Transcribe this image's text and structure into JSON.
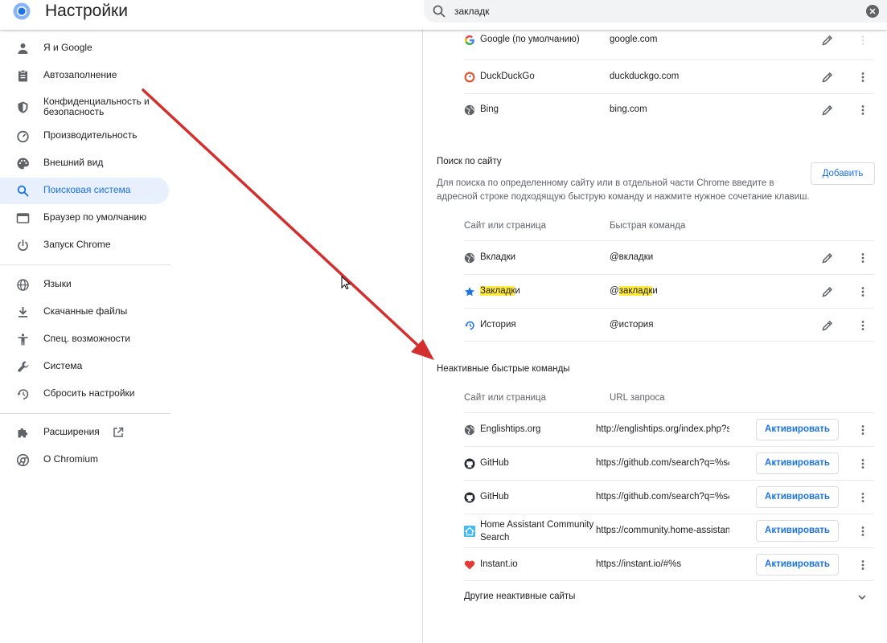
{
  "header": {
    "title": "Настройки",
    "search_value": "закладк"
  },
  "sidebar": {
    "group1": [
      {
        "label": "Я и Google",
        "icon": "person-icon"
      },
      {
        "label": "Автозаполнение",
        "icon": "clipboard-icon"
      },
      {
        "label": "Конфиденциальность и безопасность",
        "icon": "shield-icon"
      },
      {
        "label": "Производительность",
        "icon": "speedometer-icon"
      },
      {
        "label": "Внешний вид",
        "icon": "palette-icon"
      },
      {
        "label": "Поисковая система",
        "icon": "search-icon",
        "active": true
      },
      {
        "label": "Браузер по умолчанию",
        "icon": "browser-window-icon"
      },
      {
        "label": "Запуск Chrome",
        "icon": "power-icon"
      }
    ],
    "group2": [
      {
        "label": "Языки",
        "icon": "globe-icon"
      },
      {
        "label": "Скачанные файлы",
        "icon": "download-icon"
      },
      {
        "label": "Спец. возможности",
        "icon": "accessibility-icon"
      },
      {
        "label": "Система",
        "icon": "wrench-icon"
      },
      {
        "label": "Сбросить настройки",
        "icon": "history-icon"
      }
    ],
    "group3": [
      {
        "label": "Расширения",
        "icon": "puzzle-icon"
      },
      {
        "label": "О Chromium",
        "icon": "chromium-icon"
      }
    ]
  },
  "search_engines": [
    {
      "name": "Google (по умолчанию)",
      "key": "google.com",
      "icon": "google-icon"
    },
    {
      "name": "DuckDuckGo",
      "key": "duckduckgo.com",
      "icon": "duckduckgo-icon"
    },
    {
      "name": "Bing",
      "key": "bing.com",
      "icon": "globe-icon"
    }
  ],
  "site_search": {
    "title": "Поиск по сайту",
    "description": "Для поиска по определенному сайту или в отдельной части Chrome введите в адресной строке подходящую быструю команду и нажмите нужное сочетание клавиш.",
    "add_button": "Добавить",
    "col_site": "Сайт или страница",
    "col_shortcut": "Быстрая команда",
    "rows": [
      {
        "name": "Вкладки",
        "shortcut": "@вкладки",
        "icon": "globe-icon"
      },
      {
        "name_highlight": "Закладк",
        "name_rest": "и",
        "shortcut_prefix": "@",
        "shortcut_highlight": "закладк",
        "shortcut_rest": "и",
        "icon": "star-icon"
      },
      {
        "name": "История",
        "shortcut": "@история",
        "icon": "history-icon"
      }
    ]
  },
  "inactive": {
    "title": "Неактивные быстрые команды",
    "col_site": "Сайт или страница",
    "col_url": "URL запроса",
    "activate_label": "Активировать",
    "rows": [
      {
        "name": "Englishtips.org",
        "url": "http://englishtips.org/index.php?s",
        "icon": "globe-icon"
      },
      {
        "name": "GitHub",
        "url": "https://github.com/search?q=%s&",
        "icon": "github-icon"
      },
      {
        "name": "GitHub",
        "url": "https://github.com/search?q=%s&",
        "icon": "github-icon"
      },
      {
        "name_line1": "Home Assistant Community",
        "name_line2": "Search",
        "url": "https://community.home-assistan",
        "icon": "home-assistant-icon"
      },
      {
        "name": "Instant.io",
        "url": "https://instant.io/#%s",
        "icon": "heart-icon"
      }
    ],
    "other_label": "Другие неактивные сайты"
  },
  "colors": {
    "accent": "#1a73e8",
    "highlight": "#ffeb3b",
    "arrow": "#d32f2f"
  }
}
